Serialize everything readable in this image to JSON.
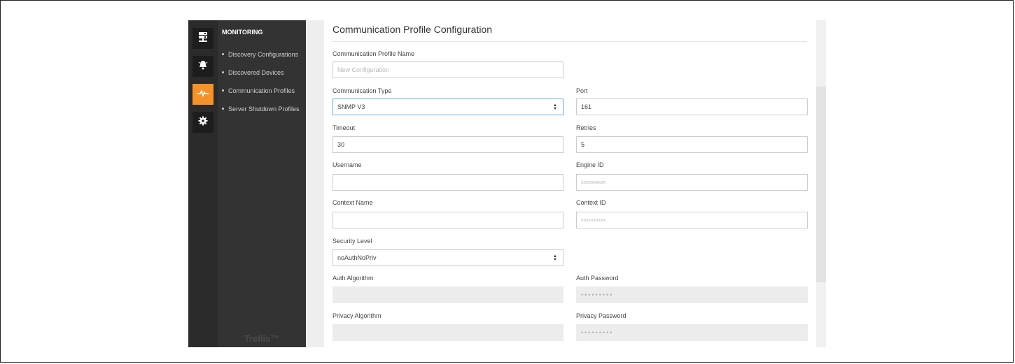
{
  "sidebar": {
    "section_title": "MONITORING",
    "items": [
      {
        "label": "Discovery Configurations"
      },
      {
        "label": "Discovered Devices"
      },
      {
        "label": "Communication Profiles"
      },
      {
        "label": "Server Shutdown Profiles"
      }
    ],
    "brand": "Trellis™"
  },
  "rail": {
    "icons": [
      "server-icon",
      "bell-icon",
      "pulse-icon",
      "gear-icon"
    ],
    "active_index": 2,
    "accent_color": "#f5922a"
  },
  "form": {
    "title": "Communication Profile Configuration",
    "profile_name": {
      "label": "Communication Profile Name",
      "value": "",
      "placeholder": "New Configuration"
    },
    "communication_type": {
      "label": "Communication Type",
      "value": "SNMP V3"
    },
    "port": {
      "label": "Port",
      "value": "161"
    },
    "timeout": {
      "label": "Timeout",
      "value": "30"
    },
    "retries": {
      "label": "Retries",
      "value": "5"
    },
    "username": {
      "label": "Username",
      "value": ""
    },
    "engine_id": {
      "label": "Engine ID",
      "value": "",
      "placeholder": "xxxxxxxxxx"
    },
    "context_name": {
      "label": "Context Name",
      "value": ""
    },
    "context_id": {
      "label": "Context ID",
      "value": "",
      "placeholder": "xxxxxxxxxx"
    },
    "security_level": {
      "label": "Security Level",
      "value": "noAuthNoPriv"
    },
    "auth_algorithm": {
      "label": "Auth Algorithm",
      "value": ""
    },
    "auth_password": {
      "label": "Auth Password",
      "value": "•••••••••"
    },
    "privacy_algorithm": {
      "label": "Privacy Algorithm",
      "value": ""
    },
    "privacy_password": {
      "label": "Privacy Password",
      "value": "•••••••••"
    }
  }
}
